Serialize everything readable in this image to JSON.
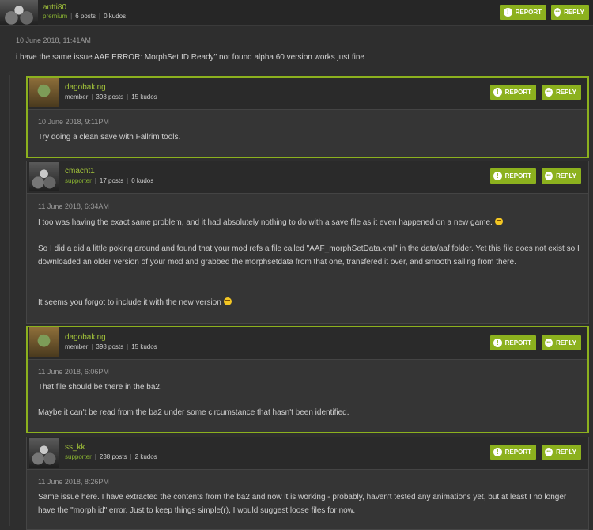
{
  "posts": [
    {
      "username": "antti80",
      "role": "premium",
      "posts": "6 posts",
      "kudos": "0 kudos",
      "date": "10 June 2018, 11:41AM",
      "body": [
        "i have the same issue AAF ERROR: MorphSet ID Ready\" not found alpha 60 version works just fine"
      ]
    },
    {
      "username": "dagobaking",
      "role": "member",
      "posts": "398 posts",
      "kudos": "15 kudos",
      "date": "10 June 2018, 9:11PM",
      "body": [
        "Try doing a clean save with Fallrim tools."
      ]
    },
    {
      "username": "cmacnt1",
      "role": "supporter",
      "posts": "17 posts",
      "kudos": "0 kudos",
      "date": "11 June 2018, 6:34AM",
      "body": [
        "I too was having the exact same problem, and it had absolutely nothing to do with a save file as it even happened on a new game.",
        "So I did a did a little poking around and found that your mod refs a file called \"AAF_morphSetData.xml\" in the data/aaf folder. Yet this file does not exist so I downloaded an older version of your mod and grabbed the morphsetdata from that one, transfered it over, and smooth sailing from there.",
        "It seems you forgot to include it with the new version"
      ]
    },
    {
      "username": "dagobaking",
      "role": "member",
      "posts": "398 posts",
      "kudos": "15 kudos",
      "date": "11 June 2018, 6:06PM",
      "body": [
        "That file should be there in the ba2.",
        "Maybe it can't be read from the ba2 under some circumstance that hasn't been identified."
      ]
    },
    {
      "username": "ss_kk",
      "role": "supporter",
      "posts": "238 posts",
      "kudos": "2 kudos",
      "date": "11 June 2018, 8:26PM",
      "body": [
        "Same issue here. I have extracted the contents from the ba2 and now it is working - probably, haven't tested any animations yet, but at least I no longer have the \"morph id\" error. Just to keep things simple(r), I would suggest loose files for now."
      ]
    }
  ],
  "buttons": {
    "report": "REPORT",
    "reply": "REPLY"
  },
  "icons": {
    "report": "!",
    "reply": "•••"
  },
  "colors": {
    "accent": "#8cb11e",
    "username": "#a3c43a",
    "background": "#2e2e2e"
  }
}
